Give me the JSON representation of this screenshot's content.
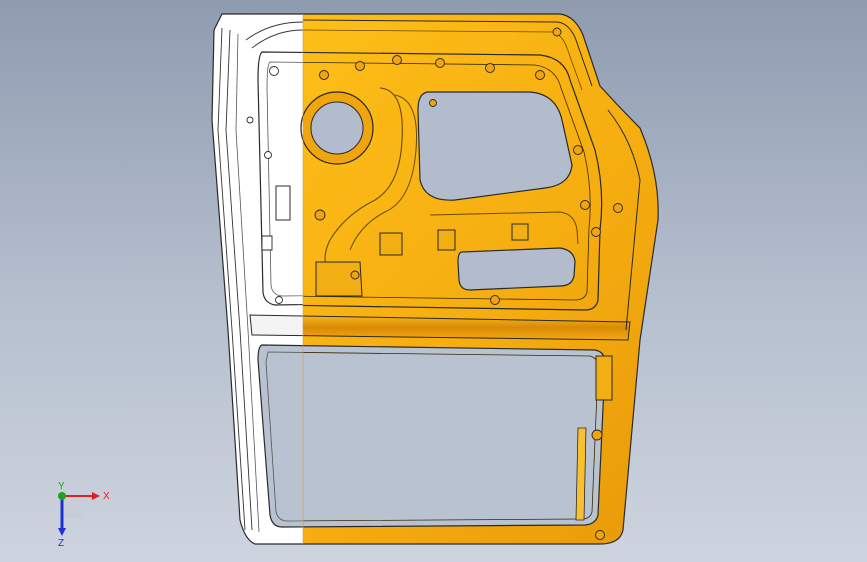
{
  "viewport": {
    "background_top": "#8f9cb0",
    "background_bottom": "#cdd4df"
  },
  "model": {
    "part": "door-inner-panel",
    "highlight_color": "#f7b311",
    "outline_color": "#2a2a2a",
    "unselected_color": "#ffffff"
  },
  "triad": {
    "x_label": "X",
    "y_label": "Y",
    "z_label": "Z",
    "x_color": "#e02020",
    "y_color": "#20a020",
    "z_color": "#2030d0"
  }
}
